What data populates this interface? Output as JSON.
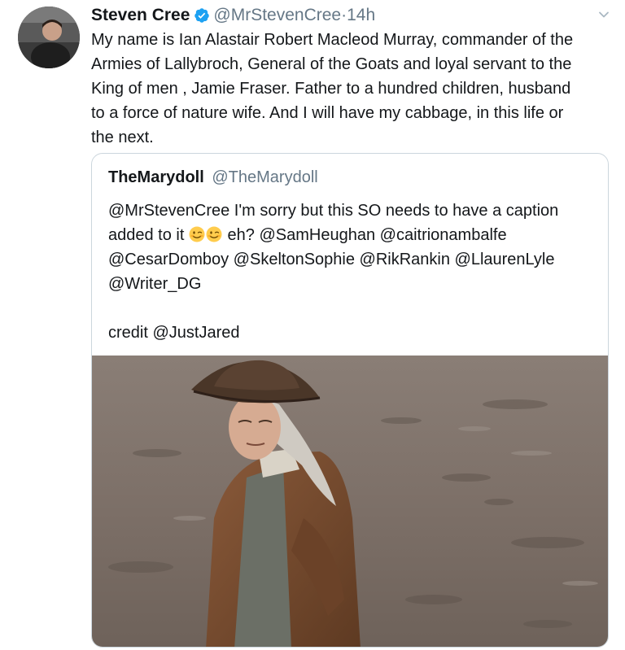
{
  "tweet": {
    "display_name": "Steven Cree",
    "handle": "@MrStevenCree",
    "separator": "·",
    "time": "14h",
    "text_lines": [
      "My name is Ian Alastair Robert Macleod Murray, commander of the",
      "Armies of Lallybroch, General of the Goats and loyal servant to the",
      "King of men , Jamie Fraser. Father to a hundred children, husband",
      "to a force of nature wife. And I will have my cabbage, in this life or",
      "the next."
    ],
    "verified_icon": "verified-badge-icon",
    "menu_icon": "chevron-down-icon",
    "accent_color": "#1da1f2"
  },
  "quoted": {
    "display_name": "TheMarydoll",
    "handle": "@TheMarydoll",
    "line1": "@MrStevenCree I'm sorry but this SO needs to have a caption",
    "line2_before": "added to it",
    "line2_after": "eh? @SamHeughan @caitrionambalfe",
    "line3": "@CesarDomboy @SkeltonSophie @RikRankin @LlaurenLyle",
    "line4": "@Writer_DG",
    "line6": "credit @JustJared",
    "emojis": [
      "winking-face-emoji",
      "winking-face-emoji"
    ],
    "photo_icon": "photo-man-tricorn-hat"
  }
}
